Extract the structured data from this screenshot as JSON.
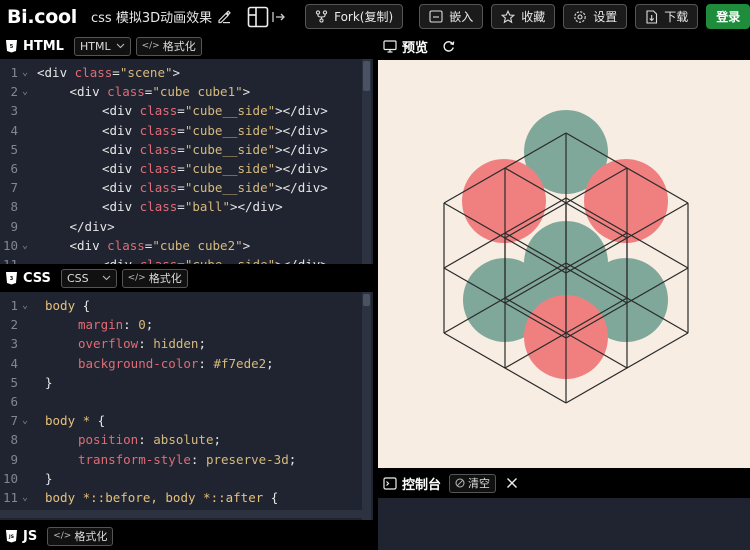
{
  "topbar": {
    "logo": "Bi.cool",
    "project_title": "css 模拟3D动画效果",
    "fork_label": "Fork(复制)",
    "embed_label": "嵌入",
    "collect_label": "收藏",
    "settings_label": "设置",
    "download_label": "下载",
    "login_label": "登录"
  },
  "html_panel": {
    "title": "HTML",
    "select_value": "HTML",
    "format_label": "格式化",
    "lines": [
      {
        "n": "1",
        "fold": true,
        "indent": 0,
        "parts": [
          [
            "t",
            "<div "
          ],
          [
            "a",
            "class"
          ],
          [
            "t",
            "="
          ],
          [
            "s",
            "\"scene\""
          ],
          [
            "t",
            ">"
          ]
        ]
      },
      {
        "n": "2",
        "fold": true,
        "indent": 1,
        "parts": [
          [
            "t",
            "<div "
          ],
          [
            "a",
            "class"
          ],
          [
            "t",
            "="
          ],
          [
            "s",
            "\"cube cube1\""
          ],
          [
            "t",
            ">"
          ]
        ]
      },
      {
        "n": "3",
        "fold": false,
        "indent": 2,
        "parts": [
          [
            "t",
            "<div "
          ],
          [
            "a",
            "class"
          ],
          [
            "t",
            "="
          ],
          [
            "s",
            "\"cube__side\""
          ],
          [
            "t",
            "></div>"
          ]
        ]
      },
      {
        "n": "4",
        "fold": false,
        "indent": 2,
        "parts": [
          [
            "t",
            "<div "
          ],
          [
            "a",
            "class"
          ],
          [
            "t",
            "="
          ],
          [
            "s",
            "\"cube__side\""
          ],
          [
            "t",
            "></div>"
          ]
        ]
      },
      {
        "n": "5",
        "fold": false,
        "indent": 2,
        "parts": [
          [
            "t",
            "<div "
          ],
          [
            "a",
            "class"
          ],
          [
            "t",
            "="
          ],
          [
            "s",
            "\"cube__side\""
          ],
          [
            "t",
            "></div>"
          ]
        ]
      },
      {
        "n": "6",
        "fold": false,
        "indent": 2,
        "parts": [
          [
            "t",
            "<div "
          ],
          [
            "a",
            "class"
          ],
          [
            "t",
            "="
          ],
          [
            "s",
            "\"cube__side\""
          ],
          [
            "t",
            "></div>"
          ]
        ]
      },
      {
        "n": "7",
        "fold": false,
        "indent": 2,
        "parts": [
          [
            "t",
            "<div "
          ],
          [
            "a",
            "class"
          ],
          [
            "t",
            "="
          ],
          [
            "s",
            "\"cube__side\""
          ],
          [
            "t",
            "></div>"
          ]
        ]
      },
      {
        "n": "8",
        "fold": false,
        "indent": 2,
        "parts": [
          [
            "t",
            "<div "
          ],
          [
            "a",
            "class"
          ],
          [
            "t",
            "="
          ],
          [
            "s",
            "\"ball\""
          ],
          [
            "t",
            "></div>"
          ]
        ]
      },
      {
        "n": "9",
        "fold": false,
        "indent": 1,
        "parts": [
          [
            "t",
            "</div>"
          ]
        ]
      },
      {
        "n": "10",
        "fold": true,
        "indent": 1,
        "parts": [
          [
            "t",
            "<div "
          ],
          [
            "a",
            "class"
          ],
          [
            "t",
            "="
          ],
          [
            "s",
            "\"cube cube2\""
          ],
          [
            "t",
            ">"
          ]
        ]
      },
      {
        "n": "11",
        "fold": false,
        "indent": 2,
        "parts": [
          [
            "t",
            "<div "
          ],
          [
            "a",
            "class"
          ],
          [
            "t",
            "="
          ],
          [
            "s",
            "\"cube__side\""
          ],
          [
            "t",
            "></div>"
          ]
        ]
      }
    ]
  },
  "css_panel": {
    "title": "CSS",
    "select_value": "CSS",
    "format_label": "格式化",
    "lines": [
      {
        "n": "1",
        "fold": true,
        "indent": 0,
        "parts": [
          [
            "sel",
            "body"
          ],
          [
            "t",
            " {"
          ]
        ]
      },
      {
        "n": "2",
        "fold": false,
        "indent": 1,
        "parts": [
          [
            "prop",
            "margin"
          ],
          [
            "t",
            ": "
          ],
          [
            "val",
            "0"
          ],
          [
            "t",
            ";"
          ]
        ]
      },
      {
        "n": "3",
        "fold": false,
        "indent": 1,
        "parts": [
          [
            "prop",
            "overflow"
          ],
          [
            "t",
            ": "
          ],
          [
            "val",
            "hidden"
          ],
          [
            "t",
            ";"
          ]
        ]
      },
      {
        "n": "4",
        "fold": false,
        "indent": 1,
        "parts": [
          [
            "prop",
            "background-color"
          ],
          [
            "t",
            ": "
          ],
          [
            "val",
            "#f7ede2"
          ],
          [
            "t",
            ";"
          ]
        ]
      },
      {
        "n": "5",
        "fold": false,
        "indent": 0,
        "parts": [
          [
            "t",
            "}"
          ]
        ]
      },
      {
        "n": "6",
        "fold": false,
        "indent": 0,
        "parts": []
      },
      {
        "n": "7",
        "fold": true,
        "indent": 0,
        "parts": [
          [
            "sel",
            "body *"
          ],
          [
            "t",
            " {"
          ]
        ]
      },
      {
        "n": "8",
        "fold": false,
        "indent": 1,
        "parts": [
          [
            "prop",
            "position"
          ],
          [
            "t",
            ": "
          ],
          [
            "val",
            "absolute"
          ],
          [
            "t",
            ";"
          ]
        ]
      },
      {
        "n": "9",
        "fold": false,
        "indent": 1,
        "parts": [
          [
            "prop",
            "transform-style"
          ],
          [
            "t",
            ": "
          ],
          [
            "val",
            "preserve-3d"
          ],
          [
            "t",
            ";"
          ]
        ]
      },
      {
        "n": "10",
        "fold": false,
        "indent": 0,
        "parts": [
          [
            "t",
            "}"
          ]
        ]
      },
      {
        "n": "11",
        "fold": true,
        "indent": 0,
        "parts": [
          [
            "sel",
            "body *::before, body *::after"
          ],
          [
            "t",
            " {"
          ]
        ]
      }
    ]
  },
  "js_panel": {
    "title": "JS",
    "format_label": "格式化"
  },
  "preview_panel": {
    "title": "预览",
    "background": "#f7ede2",
    "ball_teal": "#7fa89a",
    "ball_pink": "#f08080",
    "line_color": "#2a2a2a"
  },
  "console_panel": {
    "title": "控制台",
    "clear_label": "清空"
  },
  "colors": {
    "app_bg": "#000000",
    "editor_bg": "#1f2430",
    "login_green": "#1f8c3c"
  }
}
